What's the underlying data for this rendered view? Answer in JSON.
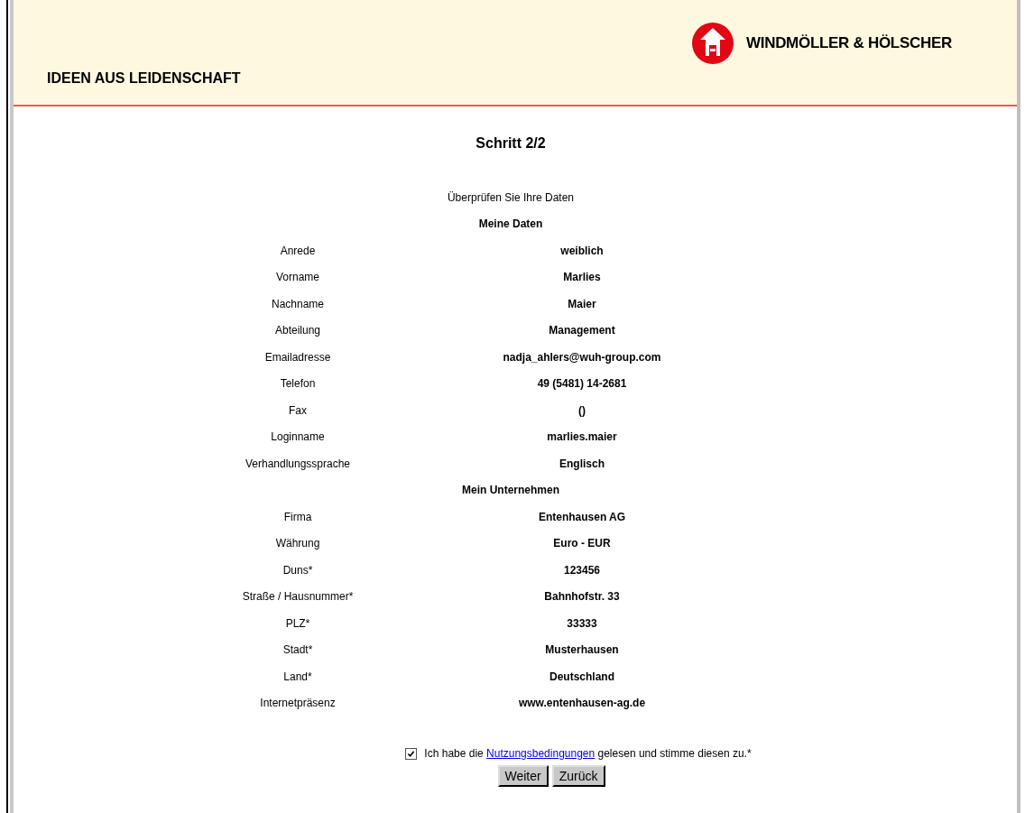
{
  "header": {
    "brand": "WINDMÖLLER & HÖLSCHER",
    "tagline": "IDEEN AUS LEIDENSCHAFT"
  },
  "title": "Schritt 2/2",
  "intro": "Überprüfen Sie Ihre Daten",
  "sections": [
    {
      "title": "Meine Daten",
      "fields": [
        {
          "label": "Anrede",
          "value": "weiblich"
        },
        {
          "label": "Vorname",
          "value": "Marlies"
        },
        {
          "label": "Nachname",
          "value": "Maier"
        },
        {
          "label": "Abteilung",
          "value": "Management"
        },
        {
          "label": "Emailadresse",
          "value": "nadja_ahlers@wuh-group.com"
        },
        {
          "label": "Telefon",
          "value": "49 (5481) 14-2681"
        },
        {
          "label": "Fax",
          "value": "()"
        },
        {
          "label": "Loginname",
          "value": "marlies.maier"
        },
        {
          "label": "Verhandlungssprache",
          "value": "Englisch"
        }
      ]
    },
    {
      "title": "Mein Unternehmen",
      "fields": [
        {
          "label": "Firma",
          "value": "Entenhausen AG"
        },
        {
          "label": "Währung",
          "value": "Euro - EUR"
        },
        {
          "label": "Duns*",
          "value": "123456"
        },
        {
          "label": "Straße / Hausnummer*",
          "value": "Bahnhofstr. 33"
        },
        {
          "label": "PLZ*",
          "value": "33333"
        },
        {
          "label": "Stadt*",
          "value": "Musterhausen"
        },
        {
          "label": "Land*",
          "value": "Deutschland"
        },
        {
          "label": "Internetpräsenz",
          "value": "www.entenhausen-ag.de"
        }
      ]
    }
  ],
  "consent": {
    "checked": true,
    "before": "Ich habe die",
    "link": "Nutzungsbedingungen",
    "after": "gelesen und stimme diesen zu.*"
  },
  "buttons": [
    "Weiter",
    "Zurück"
  ]
}
